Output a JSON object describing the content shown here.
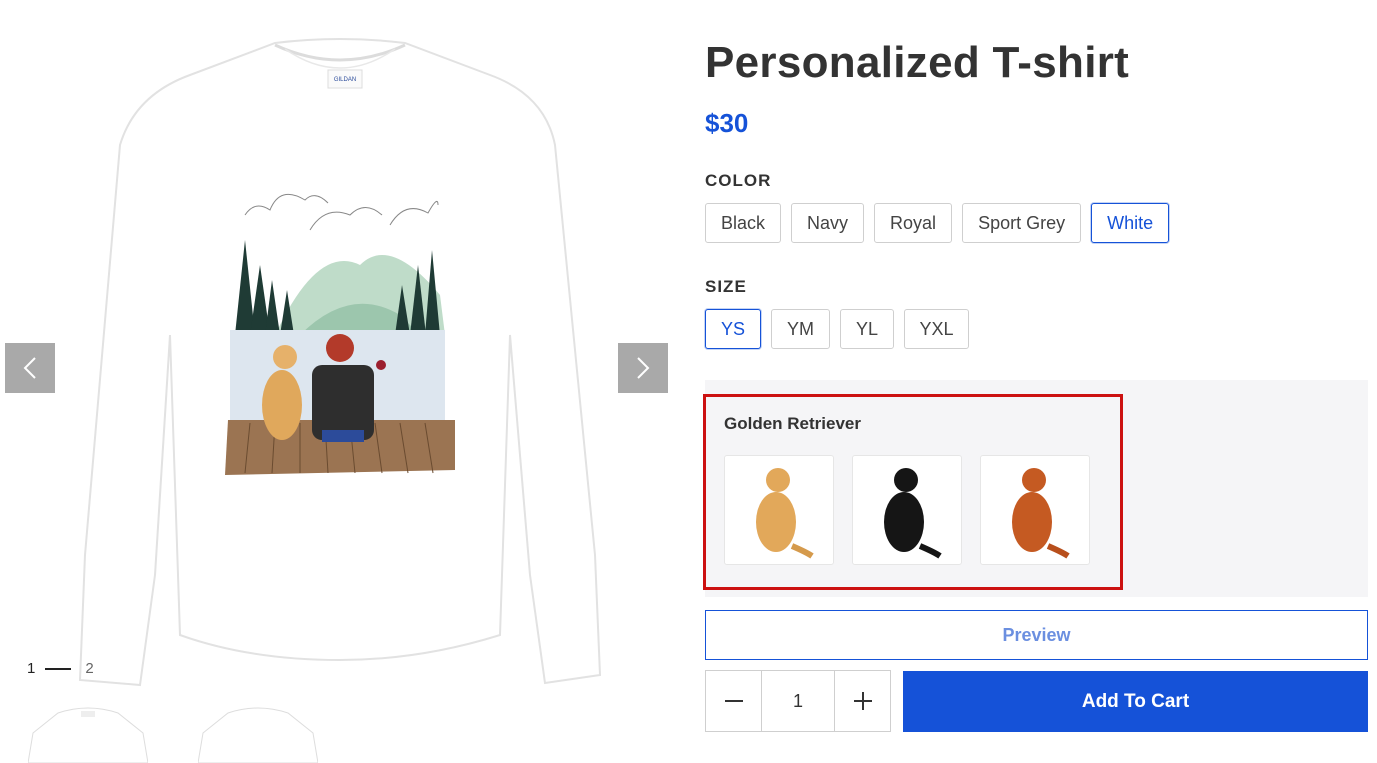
{
  "product": {
    "title": "Personalized T-shirt",
    "price": "$30"
  },
  "gallery": {
    "current_page": "1",
    "total_page": "2",
    "tag_text": "GILDAN"
  },
  "color": {
    "label": "COLOR",
    "options": [
      "Black",
      "Navy",
      "Royal",
      "Sport Grey",
      "White"
    ],
    "selected": "White"
  },
  "size": {
    "label": "SIZE",
    "options": [
      "YS",
      "YM",
      "YL",
      "YXL"
    ],
    "selected": "YS"
  },
  "customization": {
    "label": "Golden Retriever",
    "options": [
      {
        "icon": "golden-dog-icon",
        "color": "#e2a85a"
      },
      {
        "icon": "black-dog-icon",
        "color": "#151515"
      },
      {
        "icon": "red-dog-icon",
        "color": "#c55a22"
      }
    ]
  },
  "actions": {
    "preview_label": "Preview",
    "quantity": "1",
    "add_to_cart_label": "Add To Cart"
  },
  "colors": {
    "accent": "#1552d8",
    "highlight": "#cc1111",
    "panel": "#f5f5f7"
  }
}
